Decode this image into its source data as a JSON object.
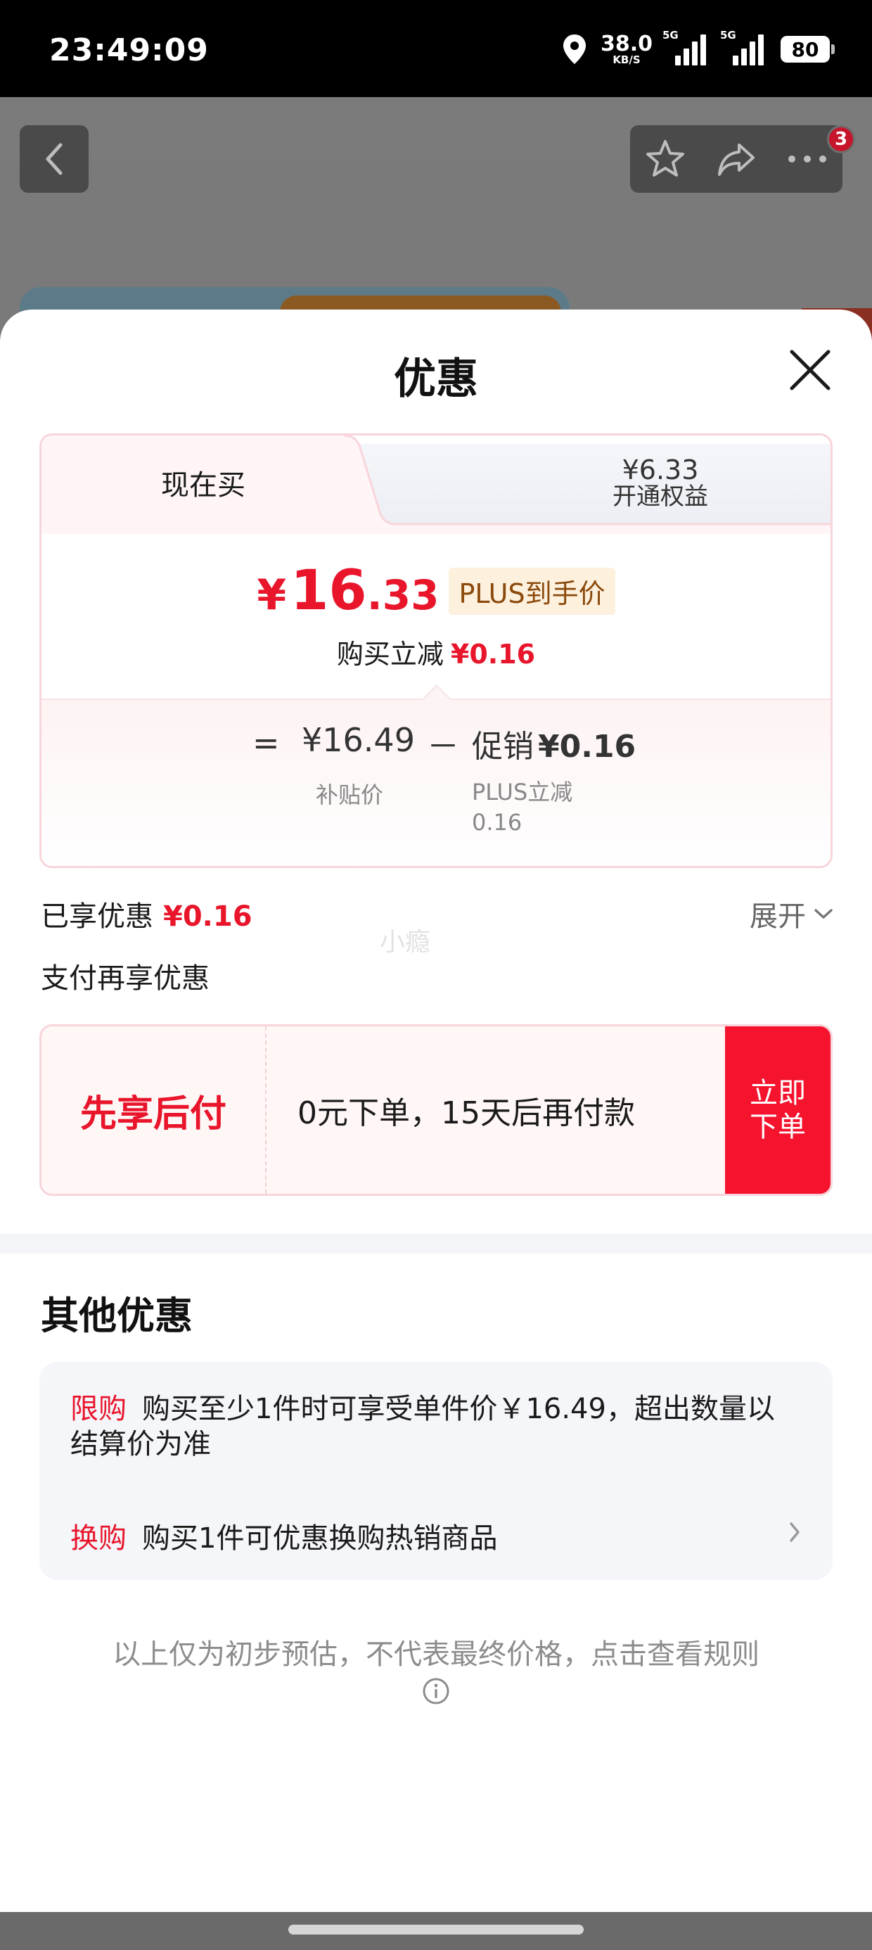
{
  "status_bar": {
    "time": "23:49:09",
    "speed_value": "38.0",
    "speed_unit": "KB/S",
    "signal1_label": "5G",
    "signal2_label": "5G",
    "battery": "80"
  },
  "background_page": {
    "badge_count": "3"
  },
  "sheet": {
    "title": "优惠",
    "tabs": {
      "now_label": "现在买",
      "plus_price": "¥6.33",
      "plus_label": "开通权益"
    },
    "price": {
      "currency": "¥",
      "integer": "16",
      "decimal": ".33",
      "plus_tag": "PLUS到手价",
      "reduce_label": "购买立减",
      "reduce_value": "¥0.16"
    },
    "breakdown": {
      "equals": "=",
      "base_price": "¥16.49",
      "base_label": "补贴价",
      "minus": "－",
      "promo_label": "促销",
      "promo_value": "¥0.16",
      "promo_sub": "PLUS立减\n0.16"
    },
    "enjoyed_label": "已享优惠",
    "enjoyed_value": "¥0.16",
    "expand_label": "展开",
    "watermark": "小瘾",
    "pay_more_label": "支付再享优惠",
    "bnpl": {
      "name": "先享后付",
      "description": "0元下单，15天后再付款",
      "button": "立即下单"
    },
    "other": {
      "title": "其他优惠",
      "items": [
        {
          "tag": "限购",
          "text": "购买至少1件时可享受单件价￥16.49，超出数量以结算价为准"
        },
        {
          "tag": "换购",
          "text": "购买1件可优惠换购热销商品"
        }
      ]
    },
    "footnote": "以上仅为初步预估，不代表最终价格，点击查看规则"
  },
  "colors": {
    "accent_red": "#e8152b",
    "button_red": "#f5132e",
    "plus_tag_bg": "#fdf0dd",
    "plus_tag_text": "#8b4a0c"
  },
  "icons": [
    "location-icon",
    "back-icon",
    "star-icon",
    "share-icon",
    "more-icon",
    "close-icon",
    "chevron-down-icon",
    "chevron-right-icon",
    "info-icon"
  ]
}
